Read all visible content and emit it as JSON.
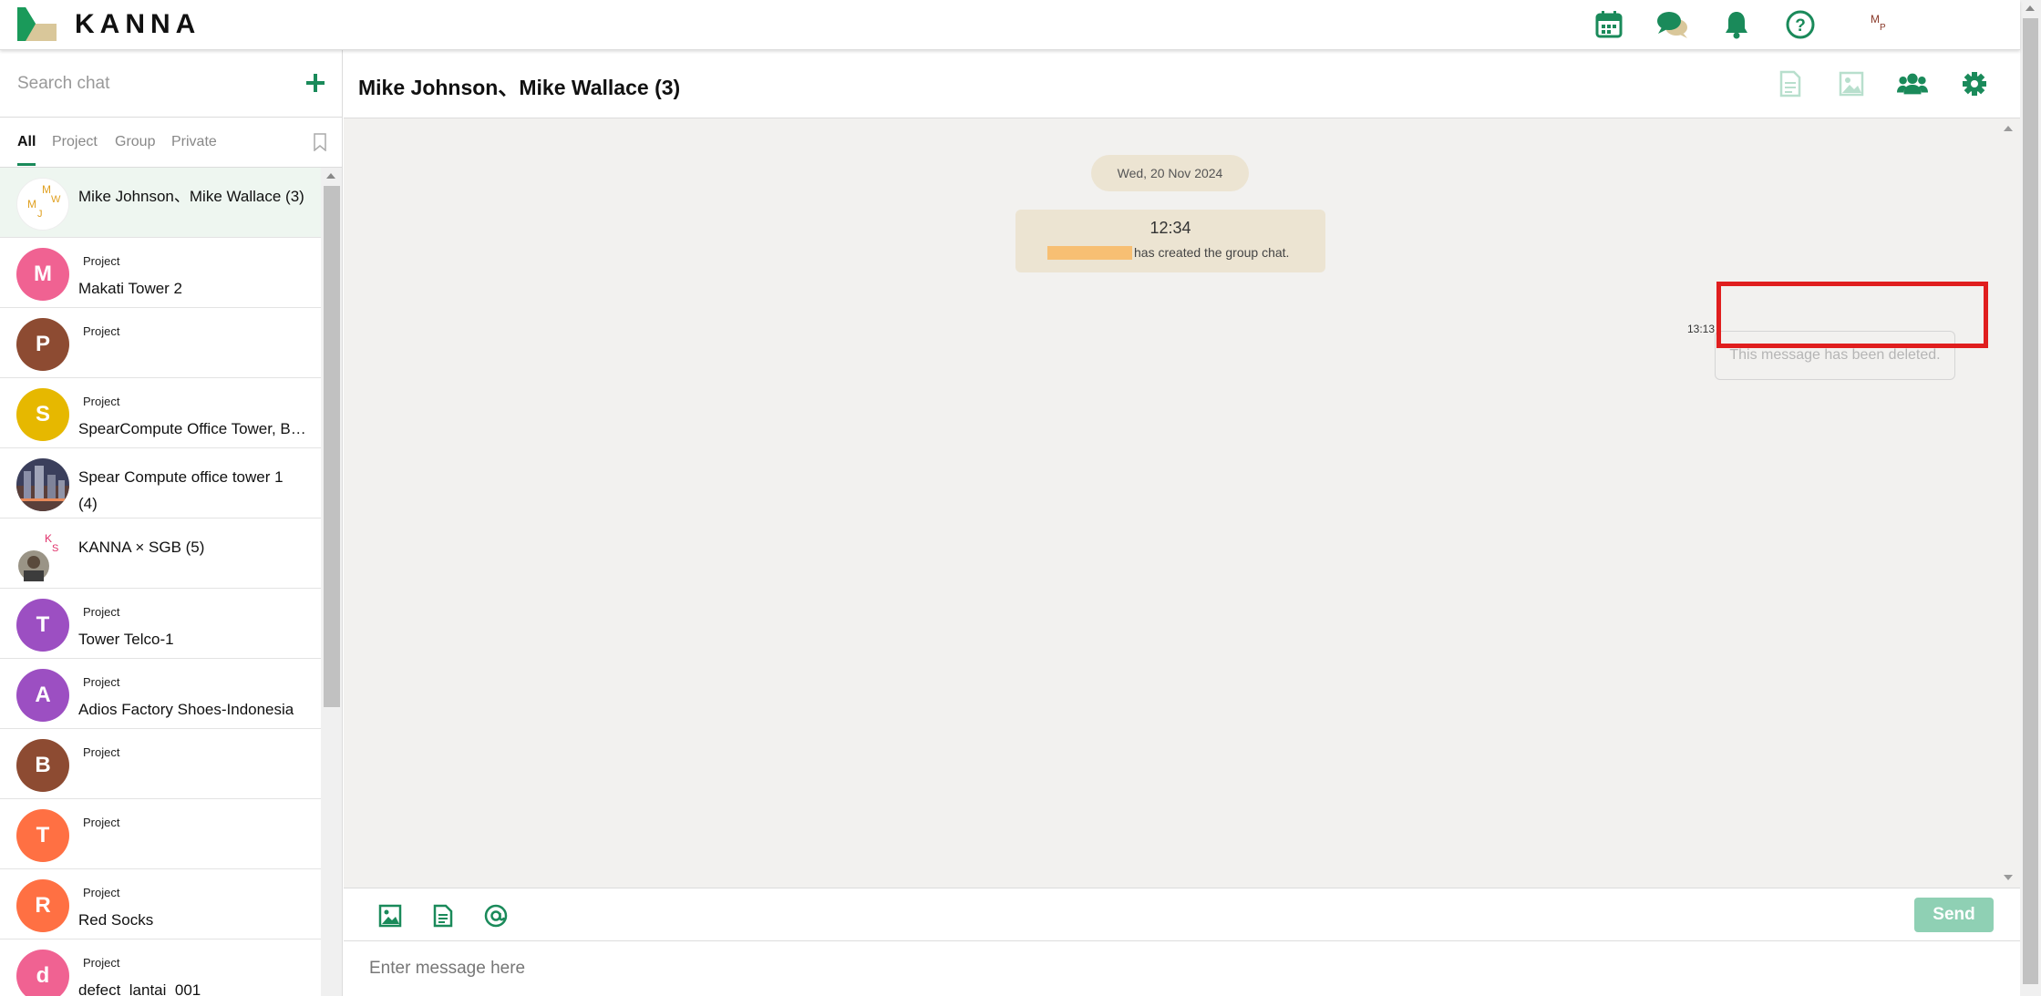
{
  "app": {
    "brand": "KANNA",
    "accent": "#1a8a5a"
  },
  "topbar": {
    "icons": [
      "calendar-icon",
      "chat-icon",
      "bell-icon",
      "help-icon"
    ],
    "user_initials_1": "M",
    "user_initials_2": "P"
  },
  "sidebar": {
    "search_placeholder": "Search chat",
    "tabs": [
      "All",
      "Project",
      "Group",
      "Private"
    ],
    "active_tab": "All",
    "items": [
      {
        "name": "Mike Johnson、Mike Wallace (3)",
        "tag": "",
        "avatar": "group",
        "initials": [
          "M",
          "W",
          "M",
          "J"
        ]
      },
      {
        "name": "Makati Tower 2",
        "tag": "Project",
        "letter": "M",
        "color": "#f06292"
      },
      {
        "name": "",
        "tag": "Project",
        "letter": "P",
        "color": "#8d4b32"
      },
      {
        "name": "SpearCompute Office Tower, Bu…",
        "tag": "Project",
        "letter": "S",
        "color": "#e6b800"
      },
      {
        "name": "Spear Compute office tower 1 (4)",
        "tag": "",
        "avatar": "photo"
      },
      {
        "name": "KANNA × SGB (5)",
        "tag": "",
        "avatar": "group-photo",
        "initials": [
          "K",
          "S"
        ]
      },
      {
        "name": "Tower Telco-1",
        "tag": "Project",
        "letter": "T",
        "color": "#9c4fc2"
      },
      {
        "name": "Adios Factory Shoes-Indonesia",
        "tag": "Project",
        "letter": "A",
        "color": "#9c4fc2"
      },
      {
        "name": "",
        "tag": "Project",
        "letter": "B",
        "color": "#8d4b32"
      },
      {
        "name": "",
        "tag": "Project",
        "letter": "T",
        "color": "#ff7043"
      },
      {
        "name": "Red Socks",
        "tag": "Project",
        "letter": "R",
        "color": "#ff7043"
      },
      {
        "name": "defect_lantai_001",
        "tag": "Project",
        "letter": "d",
        "color": "#f06292"
      }
    ]
  },
  "chat": {
    "title": "Mike Johnson、Mike Wallace (3)",
    "header_icons": [
      "file-icon",
      "image-icon",
      "members-icon",
      "settings-icon"
    ],
    "date": "Wed, 20 Nov 2024",
    "system_time": "12:34",
    "system_text": "has created the group chat.",
    "message_time": "13:13",
    "deleted_text": "This message has been deleted.",
    "send_label": "Send",
    "input_placeholder": "Enter message here"
  }
}
